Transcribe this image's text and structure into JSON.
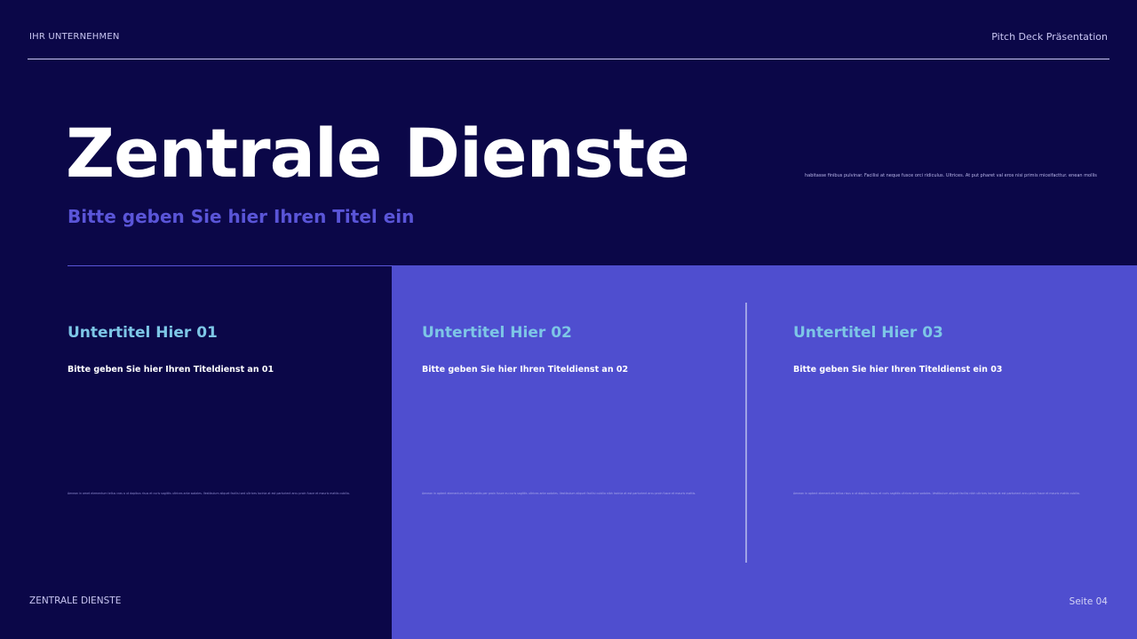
{
  "header": {
    "company": "IHR UNTERNEHMEN",
    "deck_label": "Pitch Deck Präsentation"
  },
  "hero": {
    "title": "Zentrale Dienste",
    "subtitle": "Bitte geben Sie hier Ihren Titel ein",
    "side_note": "habitasse finibus pulvinar. Facilisi at neque fusce orci ridiculus. Ultrices. At put pharet val eros nisi primis miceifacttur. enean mollis"
  },
  "columns": [
    {
      "heading": "Untertitel Hier 01",
      "subheading": "Bitte geben Sie hier Ihren Titeldienst an 01",
      "body": "Aenean in amet elementum tellus cras a ut dapibus risus et curis sagittis ultrices ante sodales. Vestibulum aliquet facilisi sed ultrices lacinia at est parturient arcu proin fusce et mauris mattis cubilia."
    },
    {
      "heading": "Untertitel Hier 02",
      "subheading": "Bitte geben Sie hier Ihren Titeldienst an 02",
      "body": "Aenean in aptent elementum tellus mattis per proin fusce eu curis sagittis ultrices ante sodales. Vestibulum aliquet facilisi cubilia nibh lacinia at est parturient arcu proin fusce et mauris mattis."
    },
    {
      "heading": "Untertitel Hier 03",
      "subheading": "Bitte geben Sie hier Ihren Titeldienst ein 03",
      "body": "Aenean in aptent elementum tellus risus a ut dapibus lacus et curis sagittis ultrices ante sodales. Vestibulum aliquet facilisi nibh ultrices lacinia at est parturient arcu proin fusce et mauris mattis cubilia."
    }
  ],
  "footer": {
    "section": "ZENTRALE DIENSTE",
    "page": "Seite 04"
  },
  "colors": {
    "background": "#0b0748",
    "panel": "#4f4ecf",
    "accent": "#5a55d8",
    "heading": "#7dc6e6"
  }
}
